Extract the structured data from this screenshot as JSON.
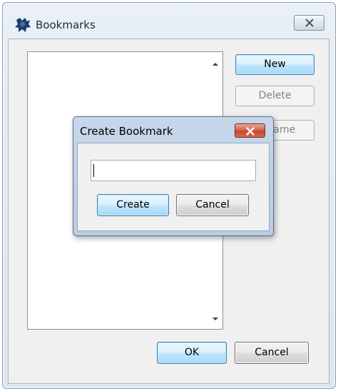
{
  "main_window": {
    "title": "Bookmarks",
    "title_icon": "bookmarks-app-icon",
    "close_icon": "close-icon",
    "buttons": {
      "new": "New",
      "delete": "Delete",
      "rename": "Rename",
      "ok": "OK",
      "cancel": "Cancel"
    },
    "bookmarks": []
  },
  "dialog": {
    "title": "Create Bookmark",
    "close_icon": "close-icon",
    "input_value": "",
    "buttons": {
      "create": "Create",
      "cancel": "Cancel"
    }
  },
  "colors": {
    "primary_button_border": "#3c7fb1",
    "dialog_close_red": "#c7452c"
  }
}
